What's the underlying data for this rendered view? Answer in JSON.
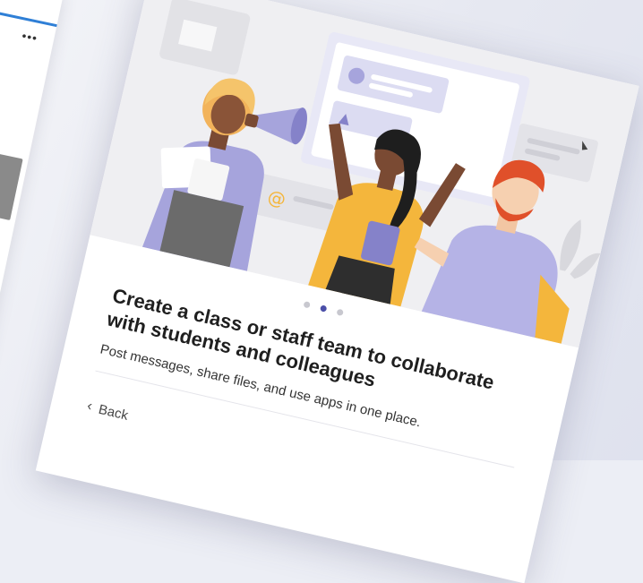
{
  "left_window": {
    "more_label": "•••",
    "chevron_glyph": "›"
  },
  "onboarding": {
    "title": "Create a class or staff team to collaborate with students and colleagues",
    "subtitle": "Post messages, share files, and use apps in one place.",
    "back_label": "Back",
    "pagination": {
      "total": 3,
      "active_index": 1
    }
  },
  "colors": {
    "accent": "#4b4fa8",
    "hero_bg": "#efeff2",
    "lavender": "#a6a4dc",
    "yellow": "#f4b63c",
    "hair_orange": "#e0502a"
  },
  "icons": [
    "more-icon",
    "chevron-right-icon",
    "chevron-left-icon",
    "megaphone-icon",
    "at-icon",
    "thumbs-up-icon",
    "cursor-icon"
  ]
}
